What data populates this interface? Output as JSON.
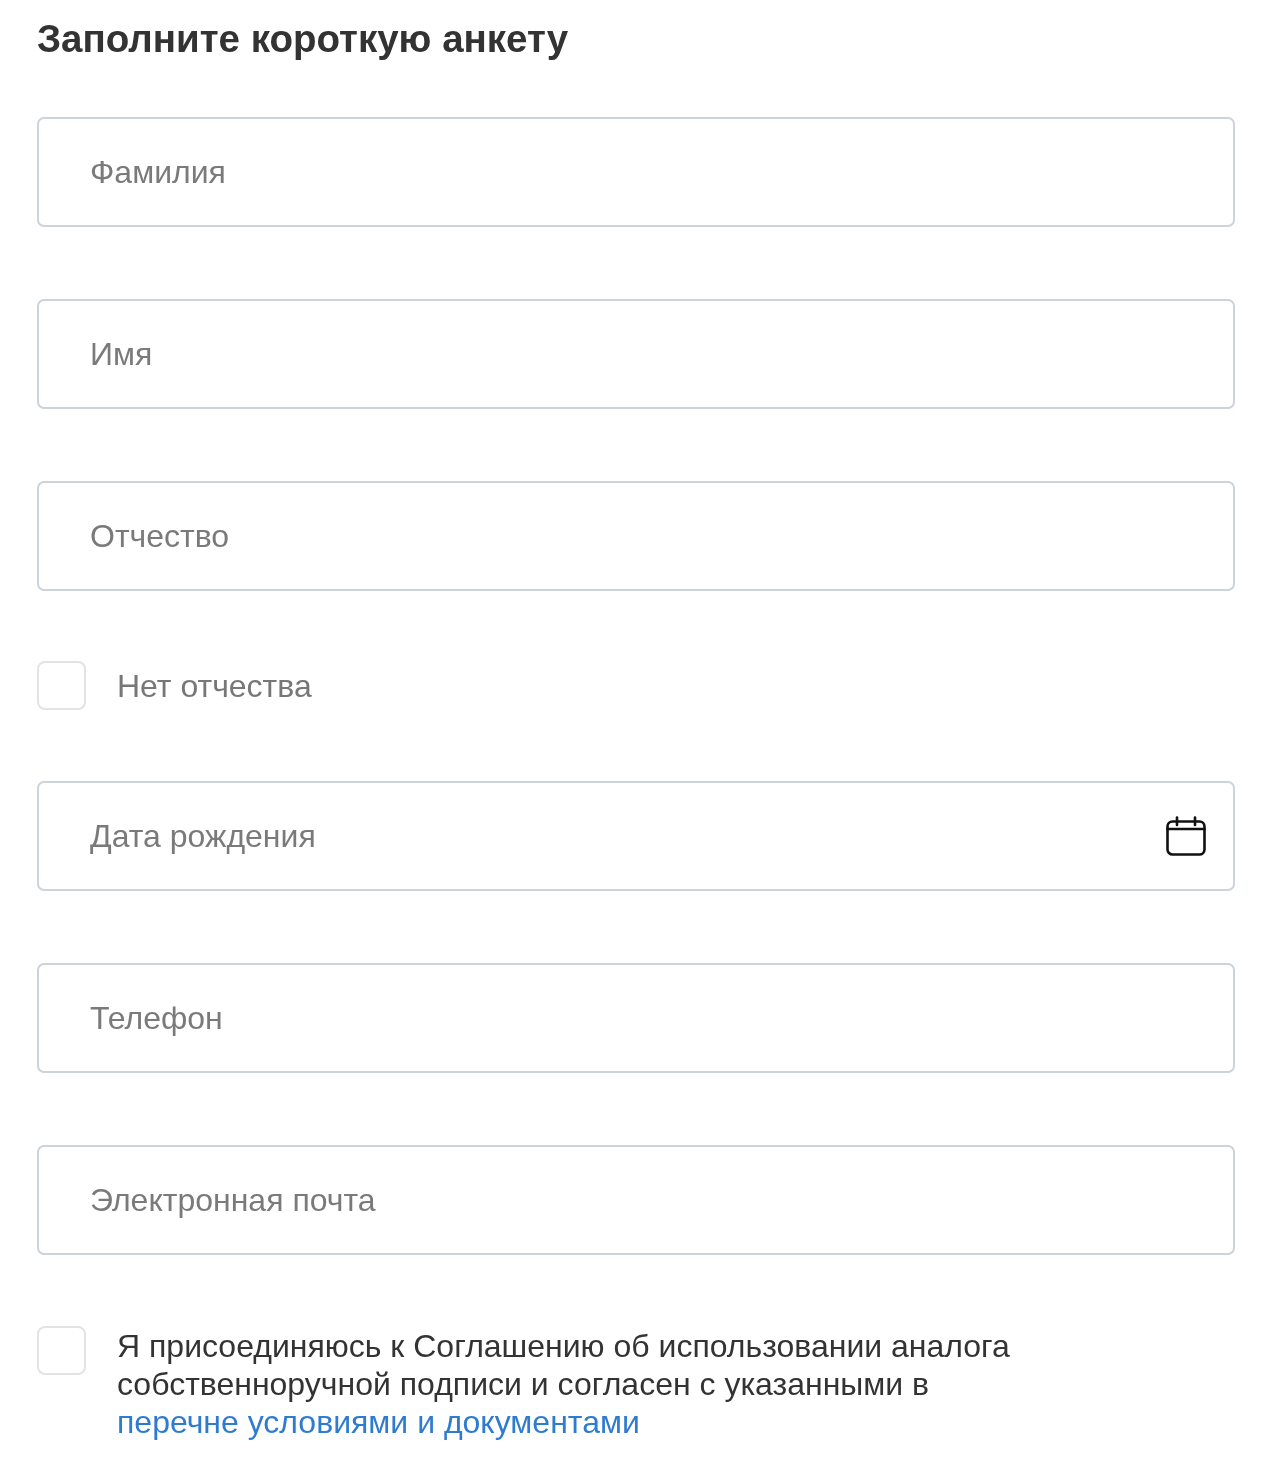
{
  "title": "Заполните короткую анкету",
  "fields": [
    {
      "kind": "text",
      "placeholder": "Фамилия"
    },
    {
      "kind": "text",
      "placeholder": "Имя"
    },
    {
      "kind": "text",
      "placeholder": "Отчество"
    },
    {
      "kind": "checkbox",
      "label": "Нет отчества",
      "checked": false
    },
    {
      "kind": "date",
      "placeholder": "Дата рождения"
    },
    {
      "kind": "text",
      "placeholder": "Телефон"
    },
    {
      "kind": "text",
      "placeholder": "Электронная почта"
    }
  ],
  "consent": {
    "checked": false,
    "text": "Я присоединяюсь к Соглашению об использовании аналога собственноручной подписи и согласен с указанными в",
    "link": "перечне условиями и документами"
  }
}
